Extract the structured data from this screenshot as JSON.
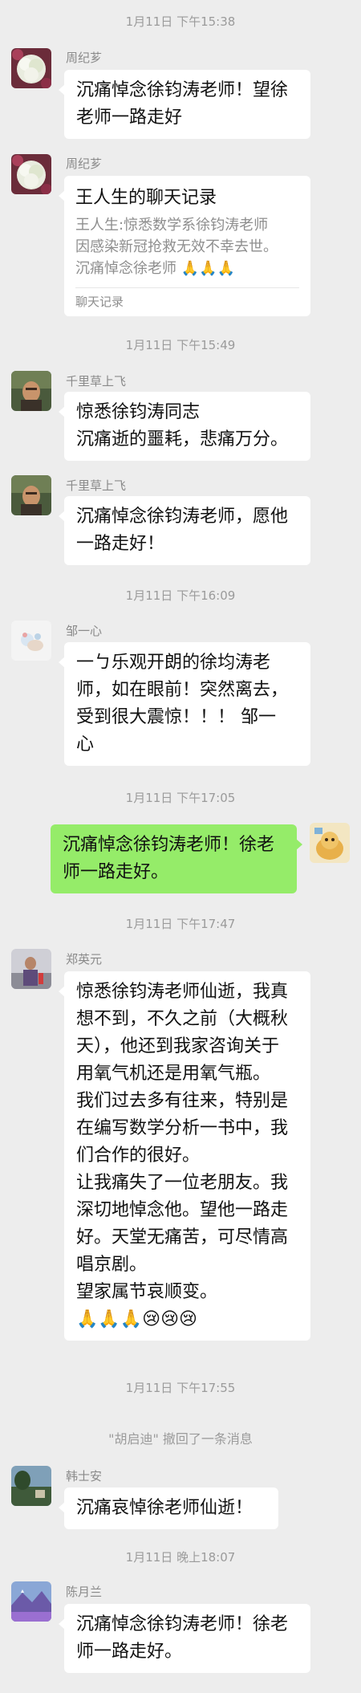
{
  "timestamps": {
    "t1": "1月11日 下午15:38",
    "t2": "1月11日 下午15:49",
    "t3": "1月11日 下午16:09",
    "t4": "1月11日 下午17:05",
    "t5": "1月11日 下午17:47",
    "t6": "1月11日 下午17:55",
    "t7": "1月11日 晚上18:07"
  },
  "messages": {
    "m1": {
      "sender": "周纪芗",
      "text": "沉痛悼念徐钧涛老师！望徐\n老师一路走好"
    },
    "m2": {
      "sender": "周纪芗",
      "card_title": "王人生的聊天记录",
      "card_body": "王人生:惊悉数学系徐钧涛老师\n因感染新冠抢救无效不幸去世。\n沉痛悼念徐老师 🙏🙏🙏",
      "card_footer": "聊天记录"
    },
    "m3": {
      "sender": "千里草上飞",
      "text": "惊悉徐钧涛同志\n沉痛逝的噩耗，悲痛万分。"
    },
    "m4": {
      "sender": "千里草上飞",
      "text": "沉痛悼念徐钧涛老师，愿他\n一路走好！"
    },
    "m5": {
      "sender": "邹一心",
      "text": "一ㄅ乐观开朗的徐均涛老\n师，如在眼前！突然离去，\n受到很大震惊！！！ 邹一\n心"
    },
    "m6": {
      "sender": "me",
      "text": "沉痛悼念徐钧涛老师！徐老\n师一路走好。"
    },
    "m7": {
      "sender": "郑英元",
      "text": "惊悉徐钧涛老师仙逝，我真\n想不到，不久之前（大概秋\n天），他还到我家咨询关于\n用氧气机还是用氧气瓶。\n我们过去多有往来，特别是\n在编写数学分析一书中，我\n们合作的很好。\n让我痛失了一位老朋友。我\n深切地悼念他。望他一路走\n好。天堂无痛苦，可尽情高\n唱京剧。\n望家属节哀顺变。\n🙏🙏🙏😢😢😢"
    },
    "m8": {
      "sender": "韩士安",
      "text": "沉痛哀悼徐老师仙逝！"
    },
    "m9": {
      "sender": "陈月兰",
      "text": "沉痛悼念徐钧涛老师！徐老\n师一路走好。"
    }
  },
  "system": {
    "recall": "\"胡启迪\" 撤回了一条消息"
  },
  "colors": {
    "background": "#ededed",
    "bubble_other": "#ffffff",
    "bubble_me": "#95ec69",
    "meta_text": "#9b9b9b"
  }
}
